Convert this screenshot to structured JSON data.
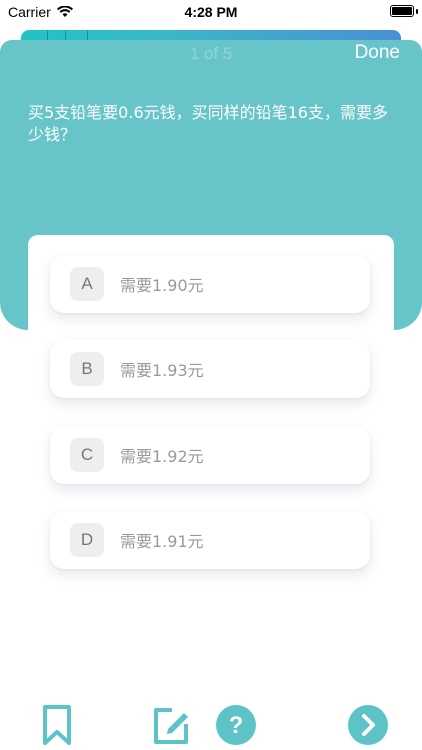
{
  "status_bar": {
    "carrier": "Carrier",
    "time": "4:28 PM"
  },
  "header": {
    "progress": "1 of 5",
    "done_label": "Done"
  },
  "question": {
    "text": "买5支铅笔要0.6元钱，买同样的铅笔16支，需要多少钱？"
  },
  "options": [
    {
      "letter": "A",
      "text": "需要1.90元"
    },
    {
      "letter": "B",
      "text": "需要1.93元"
    },
    {
      "letter": "C",
      "text": "需要1.92元"
    },
    {
      "letter": "D",
      "text": "需要1.91元"
    }
  ],
  "colors": {
    "accent": "#67c5c9",
    "icon": "#5ec3c6",
    "option_text": "#9a9a9a"
  },
  "toolbar": {
    "bookmark_icon": "bookmark-icon",
    "edit_icon": "edit-note-icon",
    "help_icon": "question-mark-icon",
    "next_icon": "chevron-right-icon"
  }
}
